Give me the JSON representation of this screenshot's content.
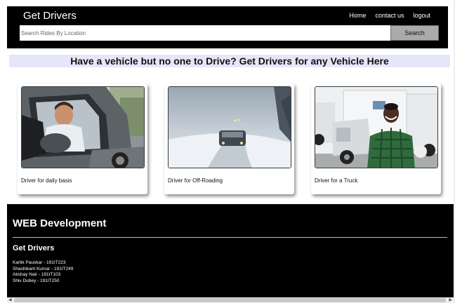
{
  "navbar": {
    "brand": "Get Drivers",
    "links": [
      "Home",
      "contact us",
      "logout"
    ],
    "search_placeholder": "Search Rides By Location",
    "search_button": "Search"
  },
  "headline": "Have a vehicle but no one to Drive? Get Drivers for any Vehicle Here",
  "cards": [
    {
      "caption": "Driver for daily basis",
      "image": "man-driving-car-photo"
    },
    {
      "caption": "Driver for Off-Roading",
      "image": "car-on-snowy-road-photo"
    },
    {
      "caption": "Driver for a Truck",
      "image": "truck-driver-photo"
    }
  ],
  "footer": {
    "title": "WEB Development",
    "subtitle": "Get Drivers",
    "members": [
      "Kartik Pauskar - 191IT223",
      "Shashikant Kumar - 191IT249",
      "Akshay Nair - 191IT103",
      "Shiv Dubey - 191IT250"
    ]
  },
  "colors": {
    "navbar_bg": "#000000",
    "headline_bg": "#e6e6fa",
    "footer_bg": "#000000",
    "search_button_bg": "#aaaaaa"
  }
}
